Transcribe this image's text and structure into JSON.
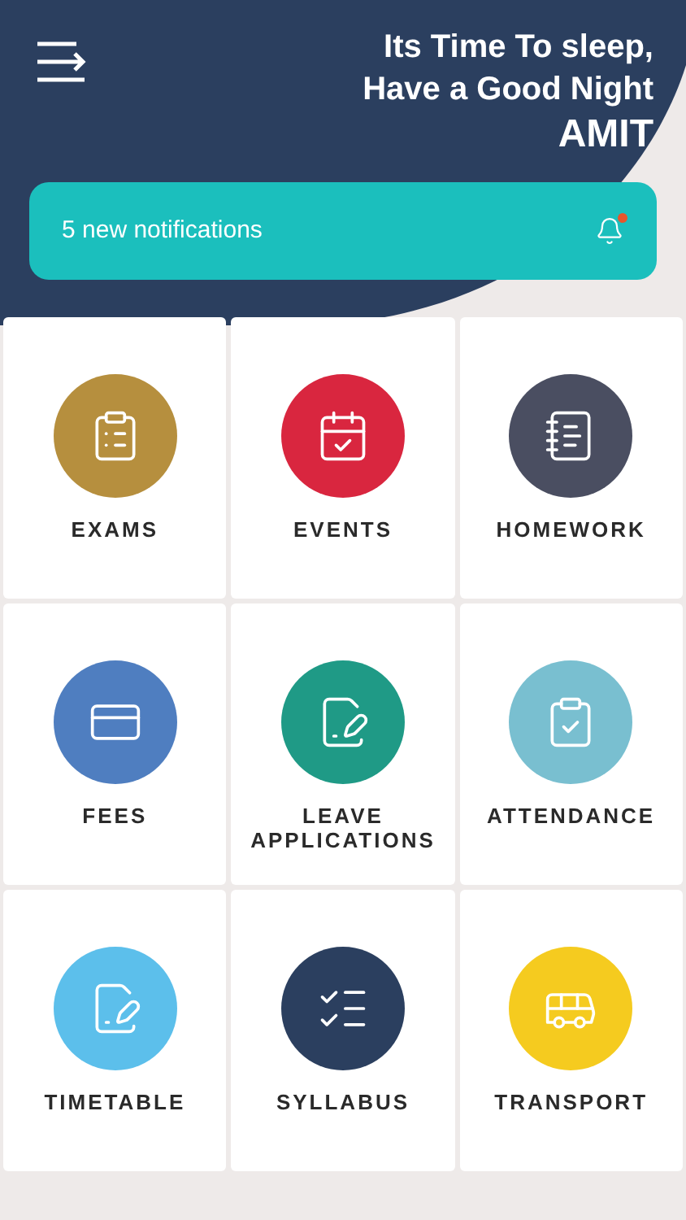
{
  "header": {
    "greeting": [
      "Its Time To sleep,",
      "Have a Good Night"
    ],
    "name": "AMIT"
  },
  "notifications": {
    "text": "5 new notifications",
    "unread": true
  },
  "tiles": [
    {
      "kind": "exams",
      "label": "EXAMS",
      "color": "#b68f3e"
    },
    {
      "kind": "events",
      "label": "EVENTS",
      "color": "#d9263f"
    },
    {
      "kind": "homework",
      "label": "HOMEWORK",
      "color": "#4a4e61"
    },
    {
      "kind": "fees",
      "label": "FEES",
      "color": "#4f7ec0"
    },
    {
      "kind": "leave",
      "label": "LEAVE APPLICATIONS",
      "color": "#1f9a86"
    },
    {
      "kind": "attendance",
      "label": "ATTENDANCE",
      "color": "#79bfd0"
    },
    {
      "kind": "timetable",
      "label": "TIMETABLE",
      "color": "#5cbfeb"
    },
    {
      "kind": "syllabus",
      "label": "SYLLABUS",
      "color": "#2b3f5f"
    },
    {
      "kind": "transport",
      "label": "TRANSPORT",
      "color": "#f5cb1f"
    }
  ]
}
